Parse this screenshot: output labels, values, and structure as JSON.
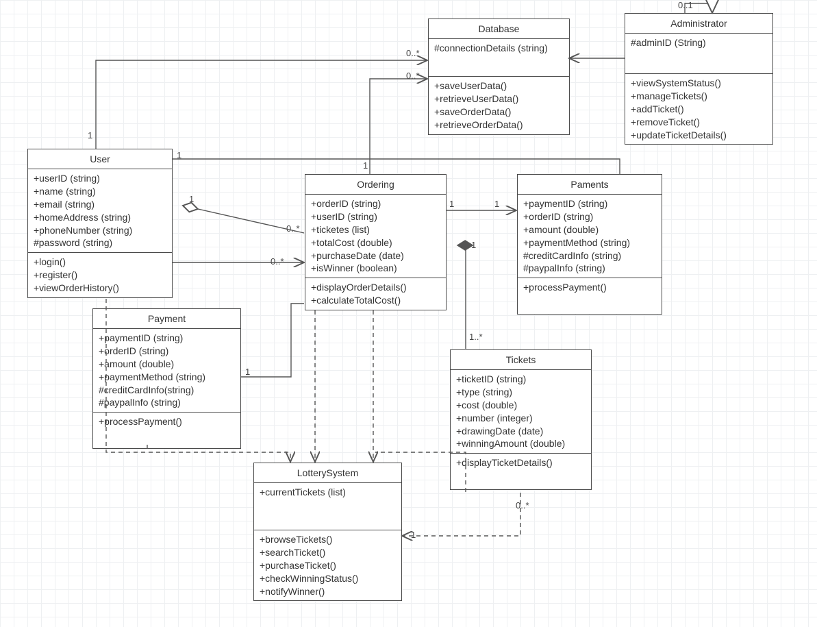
{
  "classes": {
    "database": {
      "title": "Database",
      "attrs": [
        "#connectionDetails (string)"
      ],
      "ops": [
        "+saveUserData()",
        "+retrieveUserData()",
        "+saveOrderData()",
        "+retrieveOrderData()"
      ]
    },
    "administrator": {
      "title": "Administrator",
      "attrs": [
        "#adminID (String)"
      ],
      "ops": [
        "+viewSystemStatus()",
        "+manageTickets()",
        "+addTicket()",
        "+removeTicket()",
        "+updateTicketDetails()"
      ]
    },
    "user": {
      "title": "User",
      "attrs": [
        "+userID (string)",
        "+name (string)",
        "+email (string)",
        "+homeAddress (string)",
        "+phoneNumber (string)",
        "#password (string)"
      ],
      "ops": [
        "+login()",
        "+register()",
        "+viewOrderHistory()"
      ]
    },
    "ordering": {
      "title": "Ordering",
      "attrs": [
        "+orderID (string)",
        "+userID (string)",
        "+ticketes (list)",
        "+totalCost (double)",
        "+purchaseDate (date)",
        "+isWinner (boolean)"
      ],
      "ops": [
        "+displayOrderDetails()",
        "+calculateTotalCost()"
      ]
    },
    "paments": {
      "title": "Paments",
      "attrs": [
        "+paymentID (string)",
        "+orderID (string)",
        "+amount (double)",
        "+paymentMethod (string)",
        "#creditCardInfo (string)",
        "#paypalInfo (string)"
      ],
      "ops": [
        "+processPayment()"
      ]
    },
    "payment": {
      "title": "Payment",
      "attrs": [
        "+paymentID (string)",
        "+orderID (string)",
        "+amount (double)",
        "+paymentMethod (string)",
        "#creditCardInfo(string)",
        "#paypalInfo (string)"
      ],
      "ops": [
        "+processPayment()"
      ]
    },
    "tickets": {
      "title": "Tickets",
      "attrs": [
        "+ticketID (string)",
        "+type (string)",
        "+cost (double)",
        "+number (integer)",
        "+drawingDate (date)",
        "+winningAmount (double)"
      ],
      "ops": [
        "+displayTicketDetails()"
      ]
    },
    "lotterysystem": {
      "title": "LotterySystem",
      "attrs": [
        "+currentTickets (list)"
      ],
      "ops": [
        "+browseTickets()",
        "+searchTicket()",
        "+purchaseTicket()",
        "+checkWinningStatus()",
        "+notifyWinner()"
      ]
    }
  },
  "labels": {
    "admin_self": "0..1",
    "user_db_left": "1",
    "user_db_right": "0..*",
    "ord_db_left": "1",
    "ord_db_right": "0..*",
    "user_ord_left": "1",
    "user_ord_right": "0..*",
    "user_ord_agg_left": "1",
    "user_ord_agg_right": "0..*",
    "ord_paments_left": "1",
    "ord_paments_right": "1",
    "ord_tickets_top": "1",
    "ord_tickets_bottom": "1..*",
    "payment_ord_left": "1",
    "tickets_lottery_top": "0..*",
    "tickets_lottery_bottom": "1"
  }
}
